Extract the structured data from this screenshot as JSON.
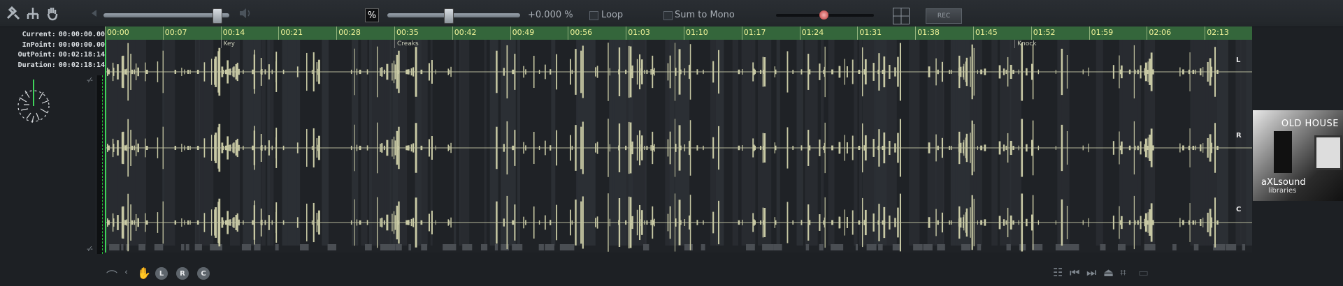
{
  "toolbar": {
    "icons": [
      "tools-icon",
      "tree-icon",
      "hand-icon",
      "volume-down-icon",
      "volume-up-icon",
      "percent-icon",
      "grid-icon"
    ],
    "percent_symbol": "%",
    "pitch_value": "+0.000 %",
    "loop_label": "Loop",
    "sum_mono_label": "Sum to Mono",
    "rec_label": "REC"
  },
  "info": {
    "current_label": "Current:",
    "current_value": "00:00:00.00",
    "inpoint_label": "InPoint:",
    "inpoint_value": "00:00:00.00",
    "outpoint_label": "OutPoint:",
    "outpoint_value": "00:02:18:14",
    "duration_label": "Duration:",
    "duration_value": "00:02:18:14"
  },
  "ruler": {
    "ticks": [
      "00:00",
      "00:07",
      "00:14",
      "00:21",
      "00:28",
      "00:35",
      "00:42",
      "00:49",
      "00:56",
      "01:03",
      "01:10",
      "01:17",
      "01:24",
      "01:31",
      "01:38",
      "01:45",
      "01:52",
      "01:59",
      "02:06",
      "02:13"
    ]
  },
  "markers": [
    {
      "label": "Key",
      "time_s": 14
    },
    {
      "label": "Creaks",
      "time_s": 35
    },
    {
      "label": "Knock",
      "time_s": 110
    }
  ],
  "channels": [
    "L",
    "R",
    "C"
  ],
  "album": {
    "title": "OLD HOUSE",
    "brand": "aXLsound",
    "sub": "libraries"
  },
  "bottom": {
    "buttons": [
      "L",
      "R",
      "C"
    ]
  },
  "colors": {
    "accent": "#34663b",
    "wave": "#c8c9a4",
    "tick_text": "#f2f59a"
  }
}
